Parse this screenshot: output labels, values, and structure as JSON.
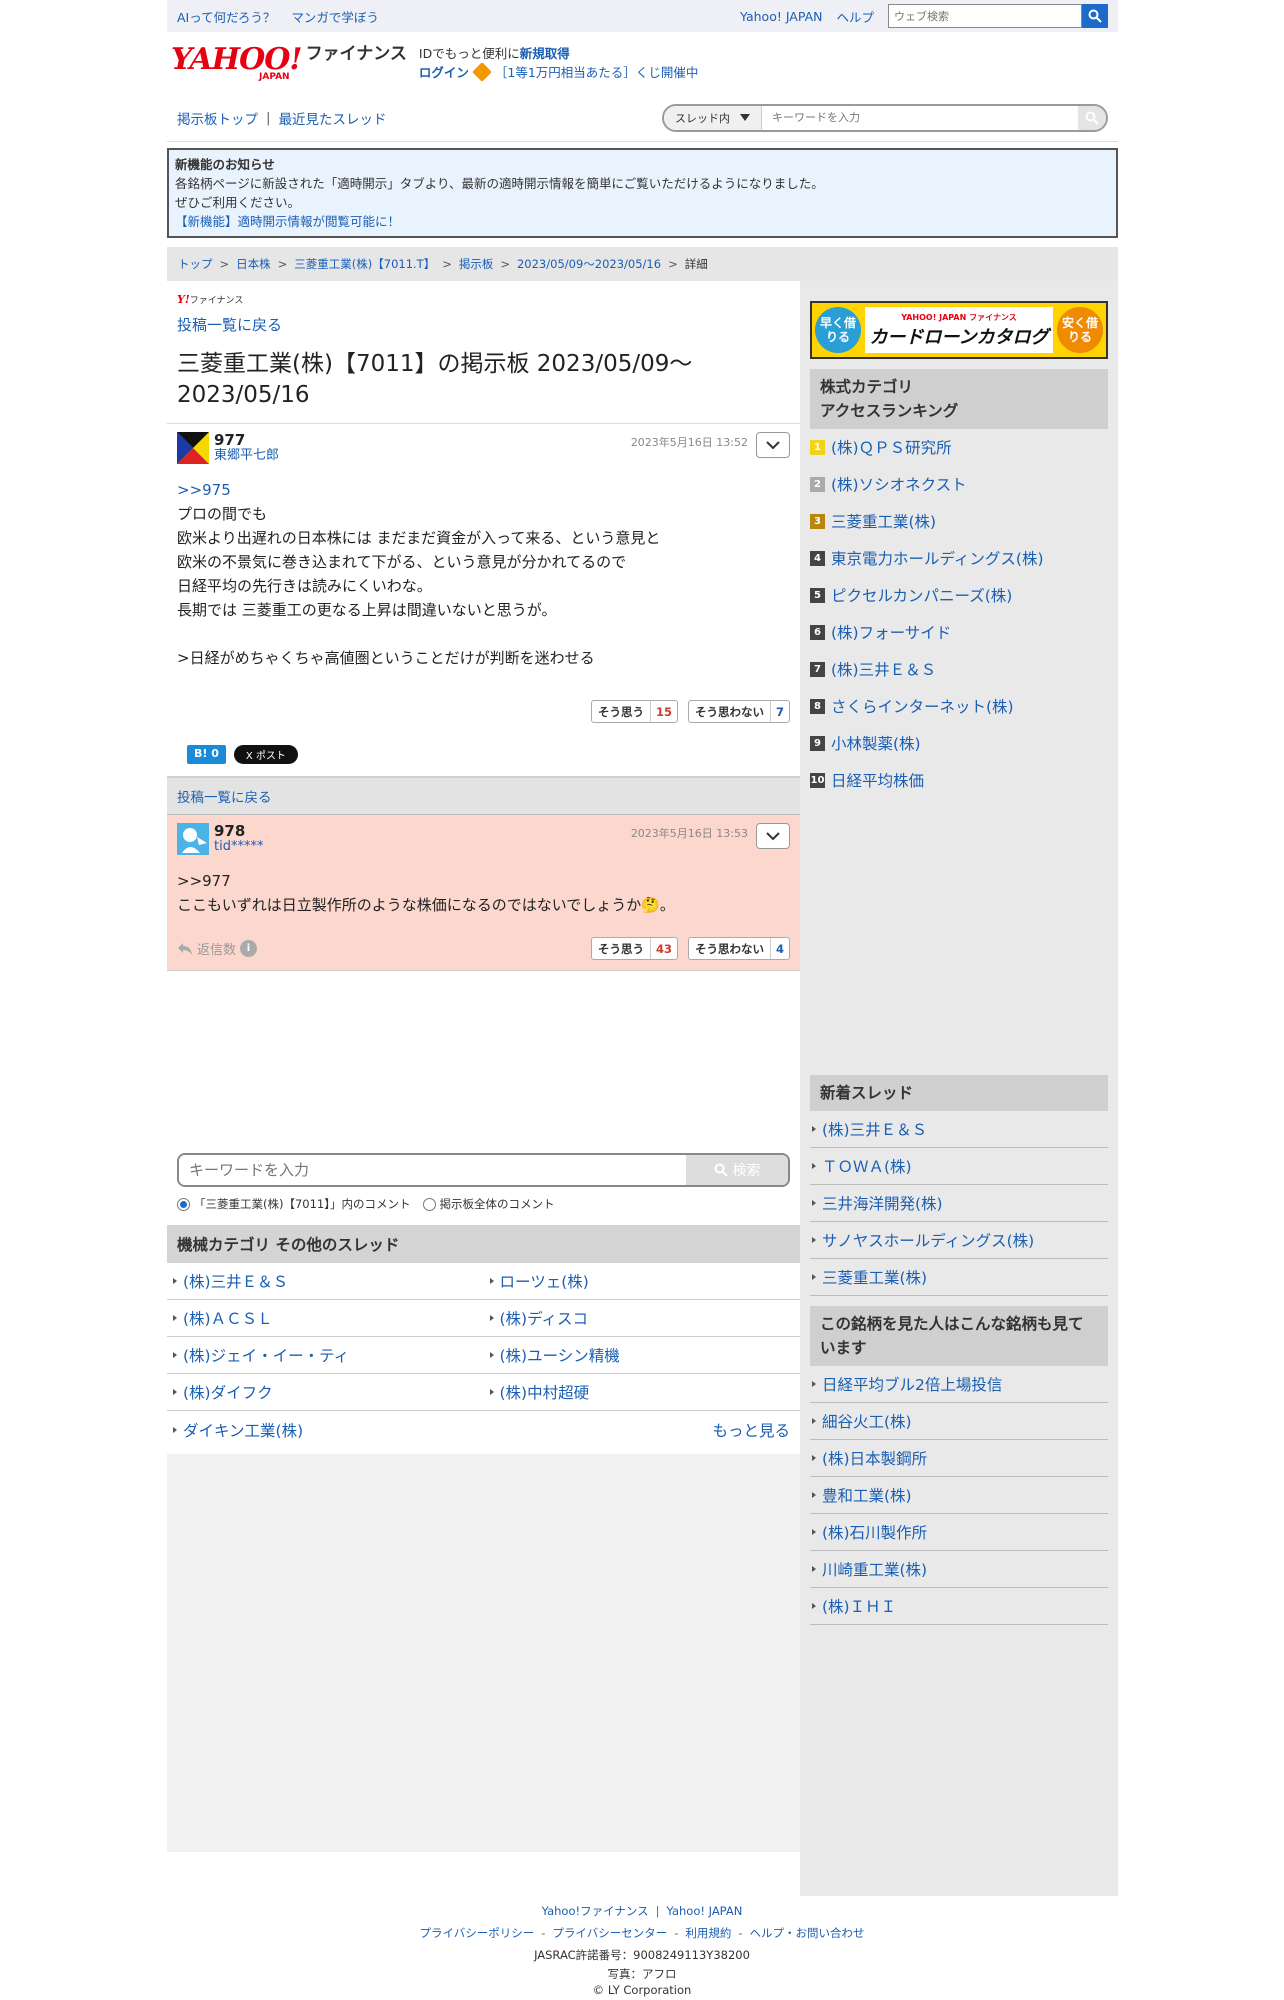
{
  "topbar": {
    "left_links": [
      "AIって何だろう？",
      "マンガで学ぼう"
    ],
    "right_links": [
      "Yahoo! JAPAN",
      "ヘルプ"
    ],
    "search_placeholder": "ウェブ検索"
  },
  "header": {
    "logo_text": "YAHOO!",
    "logo_sub": "JAPAN",
    "logo_service": "ファイナンス",
    "promo_line1_prefix": "IDでもっと便利に",
    "promo_line1_link": "新規取得",
    "promo_login": "ログイン",
    "promo_line2": "［1等1万円相当あたる］くじ開催中"
  },
  "boardnav": {
    "links": [
      "掲示板トップ",
      "最近見たスレッド"
    ],
    "separator": "|",
    "scope_label": "スレッド内",
    "search_placeholder": "キーワードを入力"
  },
  "notice": {
    "title": "新機能のお知らせ",
    "line1": "各銘柄ページに新設された「適時開示」タブより、最新の適時開示情報を簡単にご覧いただけるようになりました。",
    "line2": "ぜひご利用ください。",
    "link": "【新機能】適時開示情報が閲覧可能に！"
  },
  "breadcrumb": [
    "トップ",
    "日本株",
    "三菱重工業(株)【7011.T】",
    "掲示板",
    "2023/05/09〜2023/05/16",
    "詳細"
  ],
  "main": {
    "brand_y": "Y!",
    "brand_text": "ファイナンス",
    "back_label": "投稿一覧に戻る",
    "title": "三菱重工業(株)【7011】の掲示板 2023/05/09〜2023/05/16",
    "posts": [
      {
        "number": "977",
        "user": "東郷平七郎",
        "date": "2023年5月16日 13:52",
        "reply_to": ">>975",
        "body": "プロの間でも\n欧米より出遅れの日本株には まだまだ資金が入って来る、という意見と\n欧米の不景気に巻き込まれて下がる、という意見が分かれてるので\n日経平均の先行きは読みにくいわな。\n長期では 三菱重工の更なる上昇は間違いないと思うが。\n\n>日経がめちゃくちゃ高値圏ということだけが判断を迷わせる",
        "agree_label": "そう思う",
        "agree_count": "15",
        "disagree_label": "そう思わない",
        "disagree_count": "7",
        "hatena_label": "B!",
        "hatena_count": "0",
        "x_label": "X ポスト"
      },
      {
        "number": "978",
        "user": "tid*****",
        "date": "2023年5月16日 13:53",
        "reply_to": ">>977",
        "body": "ここもいずれは日立製作所のような株価になるのではないでしょうか🤔。",
        "reply_label": "返信数",
        "agree_label": "そう思う",
        "agree_count": "43",
        "disagree_label": "そう思わない",
        "disagree_count": "4"
      }
    ],
    "search": {
      "placeholder": "キーワードを入力",
      "button": "検索",
      "radio_thread": "「三菱重工業(株)【7011】」内のコメント",
      "radio_all": "掲示板全体のコメント"
    },
    "other_threads_title": "機械カテゴリ その他のスレッド",
    "other_threads": [
      "(株)三井Ｅ＆Ｓ",
      "ローツェ(株)",
      "(株)ＡＣＳＬ",
      "(株)ディスコ",
      "(株)ジェイ・イー・ティ",
      "(株)ユーシン精機",
      "(株)ダイフク",
      "(株)中村超硬"
    ],
    "last_thread": "ダイキン工業(株)",
    "more_label": "もっと見る"
  },
  "sidebar": {
    "banner_left": "早く借りる",
    "banner_right": "安く借りる",
    "banner_brand": "YAHOO! JAPAN ファイナンス",
    "banner_title": "カードローンカタログ",
    "ranking_title_1": "株式カテゴリ",
    "ranking_title_2": "アクセスランキング",
    "ranking": [
      {
        "rank": "1",
        "name": "(株)ＱＰＳ研究所"
      },
      {
        "rank": "2",
        "name": "(株)ソシオネクスト"
      },
      {
        "rank": "3",
        "name": "三菱重工業(株)"
      },
      {
        "rank": "4",
        "name": "東京電力ホールディングス(株)"
      },
      {
        "rank": "5",
        "name": "ピクセルカンパニーズ(株)"
      },
      {
        "rank": "6",
        "name": "(株)フォーサイド"
      },
      {
        "rank": "7",
        "name": "(株)三井Ｅ＆Ｓ"
      },
      {
        "rank": "8",
        "name": "さくらインターネット(株)"
      },
      {
        "rank": "9",
        "name": "小林製薬(株)"
      },
      {
        "rank": "10",
        "name": "日経平均株価"
      }
    ],
    "new_threads_title": "新着スレッド",
    "new_threads": [
      "(株)三井Ｅ＆Ｓ",
      "ＴＯＷＡ(株)",
      "三井海洋開発(株)",
      "サノヤスホールディングス(株)",
      "三菱重工業(株)"
    ],
    "also_viewed_title": "この銘柄を見た人はこんな銘柄も見ています",
    "also_viewed": [
      "日経平均ブル2倍上場投信",
      "細谷火工(株)",
      "(株)日本製鋼所",
      "豊和工業(株)",
      "(株)石川製作所",
      "川崎重工業(株)",
      "(株)ＩＨＩ"
    ]
  },
  "footer": {
    "row1": [
      "Yahoo!ファイナンス",
      "Yahoo! JAPAN"
    ],
    "row1_sep": "|",
    "row2": [
      "プライバシーポリシー",
      "プライバシーセンター",
      "利用規約",
      "ヘルプ・お問い合わせ"
    ],
    "row2_sep": "-",
    "jasrac": "JASRAC許諾番号：9008249113Y38200",
    "photo": "写真：アフロ",
    "copyright": "© LY Corporation"
  },
  "colors": {
    "accent": "#1a5fb4",
    "brand_red": "#e60012",
    "highlight_post": "#fcd7cd",
    "notice_bg": "#e9f3fd"
  }
}
